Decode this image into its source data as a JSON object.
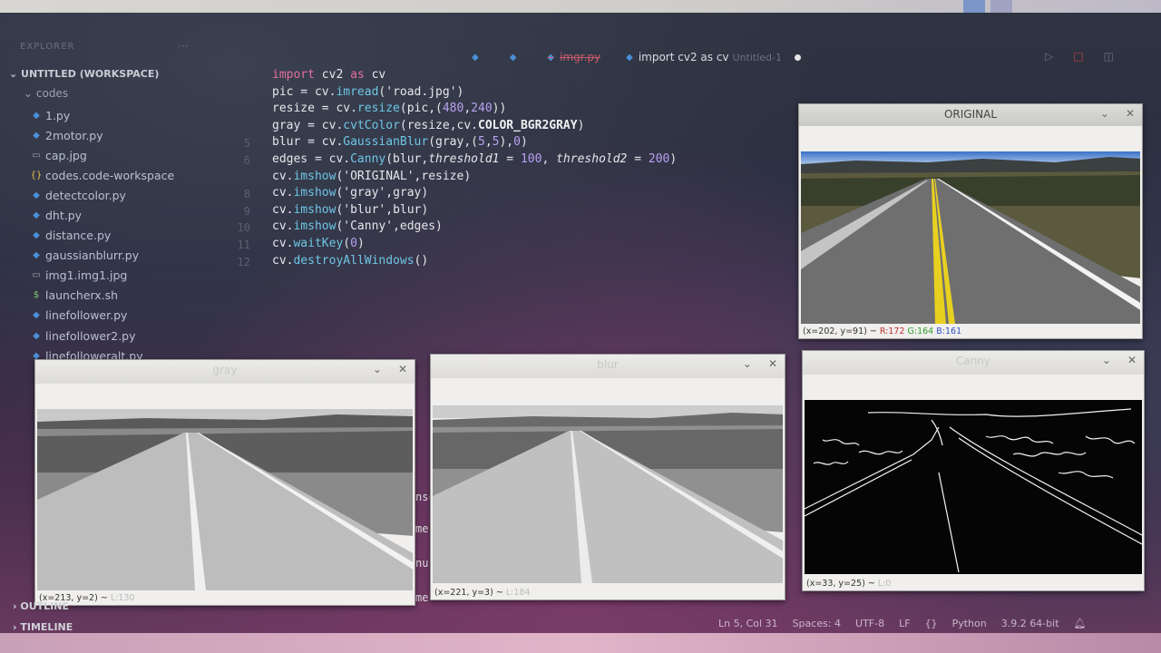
{
  "explorer": {
    "header": "EXPLORER",
    "more": "···",
    "workspace": "UNTITLED (WORKSPACE)",
    "folder": "codes",
    "files": [
      {
        "name": "1.py",
        "icon": "python-file-icon"
      },
      {
        "name": "2motor.py",
        "icon": "python-file-icon"
      },
      {
        "name": "cap.jpg",
        "icon": "image-file-icon"
      },
      {
        "name": "codes.code-workspace",
        "icon": "json-file-icon"
      },
      {
        "name": "detectcolor.py",
        "icon": "python-file-icon"
      },
      {
        "name": "dht.py",
        "icon": "python-file-icon"
      },
      {
        "name": "distance.py",
        "icon": "python-file-icon"
      },
      {
        "name": "gaussianblurr.py",
        "icon": "python-file-icon"
      },
      {
        "name": "img1.img1.jpg",
        "icon": "image-file-icon"
      },
      {
        "name": "launcherx.sh",
        "icon": "shell-file-icon"
      },
      {
        "name": "linefollower.py",
        "icon": "python-file-icon"
      },
      {
        "name": "linefollower2.py",
        "icon": "python-file-icon"
      },
      {
        "name": "linefolloweralt.py",
        "icon": "python-file-icon"
      }
    ],
    "outline": "OUTLINE",
    "timeline": "TIMELINE"
  },
  "tabs": [
    {
      "label": "",
      "state": "inactive"
    },
    {
      "label": "imgr.py",
      "state": "deleted"
    },
    {
      "label": "import cv2 as cv",
      "sub": "Untitled-1",
      "state": "active-unsaved"
    }
  ],
  "code": {
    "line_numbers": [
      "",
      "",
      "",
      "",
      "5",
      "6",
      "",
      "8",
      "9",
      "10",
      "11",
      "12"
    ],
    "lines": [
      "import cv2 as cv",
      "pic = cv.imread('road.jpg')",
      "resize = cv.resize(pic,(480,240))",
      "gray = cv.cvtColor(resize,cv.COLOR_BGR2GRAY)",
      "blur = cv.GaussianBlur(gray,(5,5),0)",
      "edges = cv.Canny(blur,threshold1 = 100, threshold2 = 200)",
      "cv.imshow('ORIGINAL',resize)",
      "cv.imshow('gray',gray)",
      "cv.imshow('blur',blur)",
      "cv.imshow('Canny',edges)",
      "cv.waitKey(0)",
      "cv.destroyAllWindows()"
    ]
  },
  "windows": {
    "original": {
      "title": "ORIGINAL",
      "status_pos": "(x=202, y=91) ~ ",
      "status_r": "R:172",
      "status_g": "G:164",
      "status_b": "B:161"
    },
    "gray": {
      "title": "gray",
      "status_pos": "(x=213, y=2) ~",
      "status_val": "L:130"
    },
    "blur": {
      "title": "blur",
      "status_pos": "(x=221, y=3) ~",
      "status_val": "L:184"
    },
    "canny": {
      "title": "Canny",
      "status_pos": "(x=33, y=25) ~",
      "status_val": "L:0"
    }
  },
  "peek": [
    "nsc",
    "me",
    "nu",
    "me"
  ],
  "statusbar": {
    "position": "Ln 5, Col 31",
    "spaces": "Spaces: 4",
    "encoding": "UTF-8",
    "eol": "LF",
    "language": "Python",
    "version": "3.9.2 64-bit"
  },
  "colors": {
    "accent": "#4a90d9",
    "keyword": "#e46f9c",
    "function": "#6ec6e6"
  }
}
